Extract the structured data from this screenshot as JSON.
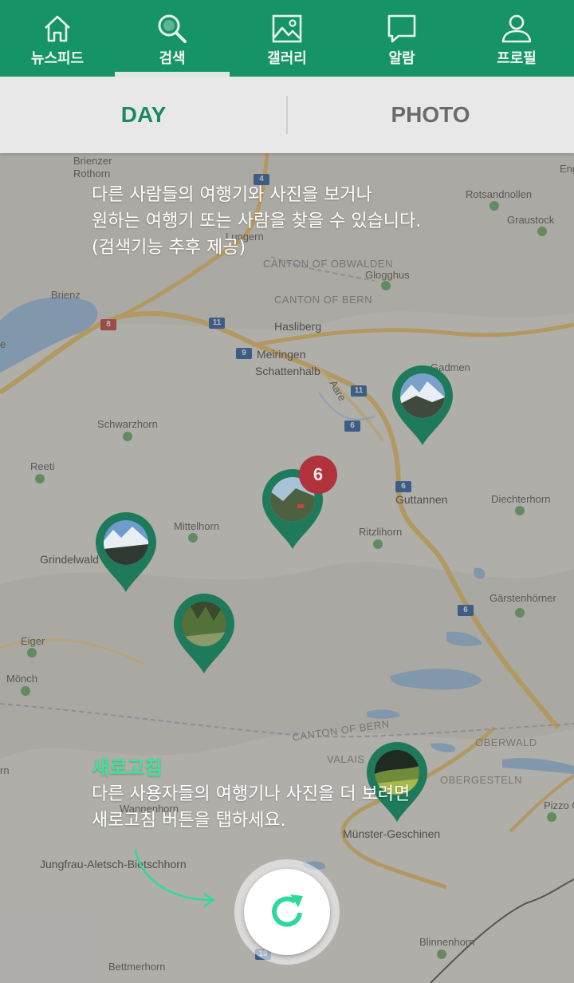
{
  "nav": {
    "items": [
      {
        "label": "뉴스피드",
        "icon": "home-icon"
      },
      {
        "label": "검색",
        "icon": "search-icon",
        "active": true
      },
      {
        "label": "갤러리",
        "icon": "gallery-icon"
      },
      {
        "label": "알람",
        "icon": "chat-bubble-icon"
      },
      {
        "label": "프로필",
        "icon": "person-icon"
      }
    ],
    "color": "#169467"
  },
  "tabs": [
    {
      "label": "DAY",
      "active": true
    },
    {
      "label": "PHOTO",
      "active": false
    }
  ],
  "map": {
    "labels": {
      "brienz": "Brienz",
      "brienzer": "Brienzer",
      "rothorn": "Rothorn",
      "lungern": "Lungern",
      "rotsandnollen": "Rotsandnollen",
      "graustock": "Graustock",
      "eng": "Eng",
      "canton_obwalden": "CANTON OF OBWALDEN",
      "glogghus": "Glogghus",
      "canton_bern": "CANTON OF BERN",
      "hasliberg": "Hasliberg",
      "meiringen": "Meiringen",
      "schattenhalb": "Schattenhalb",
      "gadmen": "Gadmen",
      "aare": "Aare",
      "schwarzhorn": "Schwarzhorn",
      "reeti": "Reeti",
      "guttannen": "Guttannen",
      "diechterhorn": "Diechterhorn",
      "mittelhorn": "Mittelhorn",
      "ritzlihorn": "Ritzlihorn",
      "grindelwald": "Grindelwald",
      "gaerstenhorner": "Gärstenhörner",
      "eiger": "Eiger",
      "moench": "Mönch",
      "canton_bern_2": "CANTON OF BERN",
      "oberwald": "OBERWALD",
      "valais": "VALAIS",
      "obergesteln": "OBERGESTELN",
      "pizzo_gallina": "Pizzo Gal",
      "wannenhorn": "Wannenhorn",
      "muenster": "Münster-Geschinen",
      "jungfrau": "Jungfrau-Aletsch-Bietschhorn",
      "binnenhorn": "Blinnenhorn",
      "bettmerhorn": "Bettmerhorn",
      "e_left": "e",
      "rn_left": "rn"
    },
    "route_numbers": {
      "r11a": "11",
      "r8": "8",
      "r9": "9",
      "r11b": "11",
      "r6a": "6",
      "r6b": "6",
      "r6c": "6",
      "r19": "19",
      "r4": "4"
    }
  },
  "pins": [
    {
      "name": "pin-gadmen",
      "badge": null
    },
    {
      "name": "pin-guttannen",
      "badge": "6"
    },
    {
      "name": "pin-grindelwald",
      "badge": null
    },
    {
      "name": "pin-eiger",
      "badge": null
    },
    {
      "name": "pin-obergesteln",
      "badge": null
    }
  ],
  "guide": {
    "search_lines": [
      "다른 사람들의 여행기와 사진을 보거나",
      "원하는 여행기 또는 사람을 찾을 수 있습니다.",
      "(검색기능 추후 제공)"
    ],
    "refresh_title": "새로고침",
    "refresh_lines": [
      "다른 사용자들의 여행기나 사진을 더 보려면",
      "새로고침 버튼을 탭하세요."
    ]
  },
  "refresh_button": {
    "icon": "refresh-icon",
    "color": "#2dd99a"
  }
}
